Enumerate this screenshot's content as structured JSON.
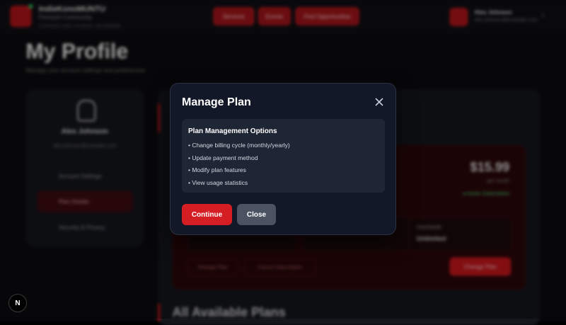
{
  "background": {
    "brand": {
      "name": "IndieKonoMUNTU",
      "subtitle": "Premium Community",
      "tagline": "Connect with creators worldwide"
    },
    "nav": [
      "Services",
      "Events",
      "Find Opportunities"
    ],
    "user": {
      "name": "Alex Johnson",
      "email": "alex.johnson@example.com"
    },
    "page_title": "My Profile",
    "page_subtitle": "Manage your account settings and preferences",
    "sidebar": {
      "name": "Alex Johnson",
      "email": "alex.johnson@example.com",
      "items": [
        "Account Settings",
        "Plan Details",
        "Security & Privacy"
      ]
    },
    "plan": {
      "price": "$15.99",
      "period": "per month",
      "status": "● Active Subscription",
      "stat_label": "Downloads",
      "stat_value": "Unlimited",
      "btn_manage": "Manage Plan",
      "btn_cancel": "Cancel Subscription",
      "btn_change": "Change Plan"
    },
    "section_title": "All Available Plans"
  },
  "modal": {
    "title": "Manage Plan",
    "info_heading": "Plan Management Options",
    "options": [
      "• Change billing cycle (monthly/yearly)",
      "• Update payment method",
      "• Modify plan features",
      "• View usage statistics"
    ],
    "continue_label": "Continue",
    "close_label": "Close"
  },
  "badge": "N",
  "colors": {
    "accent": "#d41e24",
    "modal_bg": "#121827",
    "secondary": "#4b5363"
  }
}
